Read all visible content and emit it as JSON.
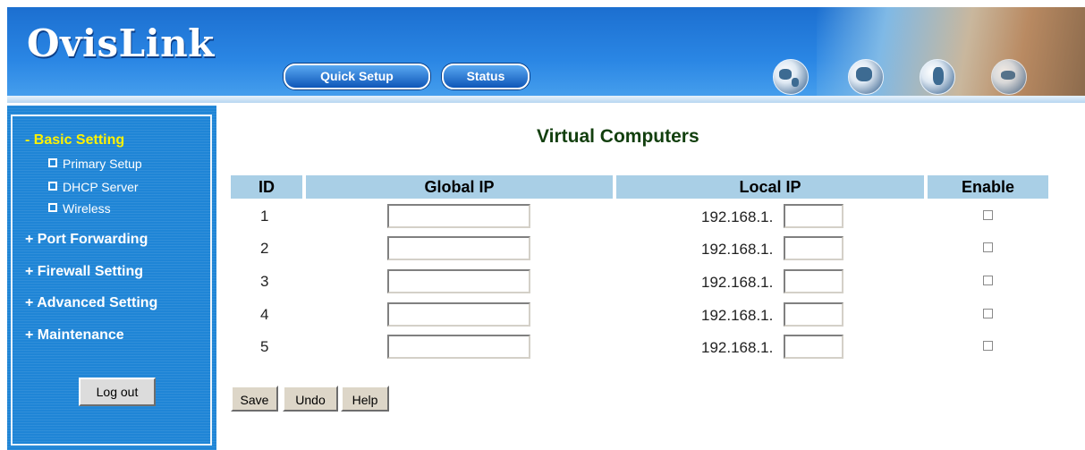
{
  "header": {
    "logo": "OvisLink",
    "quick_setup_label": "Quick Setup",
    "status_label": "Status"
  },
  "sidebar": {
    "basic_setting": "- Basic Setting",
    "sub_items": [
      "Primary Setup",
      "DHCP Server",
      "Wireless"
    ],
    "port_forwarding": "+ Port Forwarding",
    "firewall_setting": "+ Firewall Setting",
    "advanced_setting": "+ Advanced Setting",
    "maintenance": "+ Maintenance",
    "logout_label": "Log out",
    "active_color": "#fff200"
  },
  "main": {
    "title": "Virtual Computers",
    "columns": [
      "ID",
      "Global IP",
      "Local IP",
      "Enable"
    ],
    "rows": [
      {
        "id": "1",
        "global_ip": "",
        "local_prefix": "192.168.1.",
        "local_suffix": "",
        "enabled": false
      },
      {
        "id": "2",
        "global_ip": "",
        "local_prefix": "192.168.1.",
        "local_suffix": "",
        "enabled": false
      },
      {
        "id": "3",
        "global_ip": "",
        "local_prefix": "192.168.1.",
        "local_suffix": "",
        "enabled": false
      },
      {
        "id": "4",
        "global_ip": "",
        "local_prefix": "192.168.1.",
        "local_suffix": "",
        "enabled": false
      },
      {
        "id": "5",
        "global_ip": "",
        "local_prefix": "192.168.1.",
        "local_suffix": "",
        "enabled": false
      }
    ],
    "save_label": "Save",
    "undo_label": "Undo",
    "help_label": "Help"
  }
}
